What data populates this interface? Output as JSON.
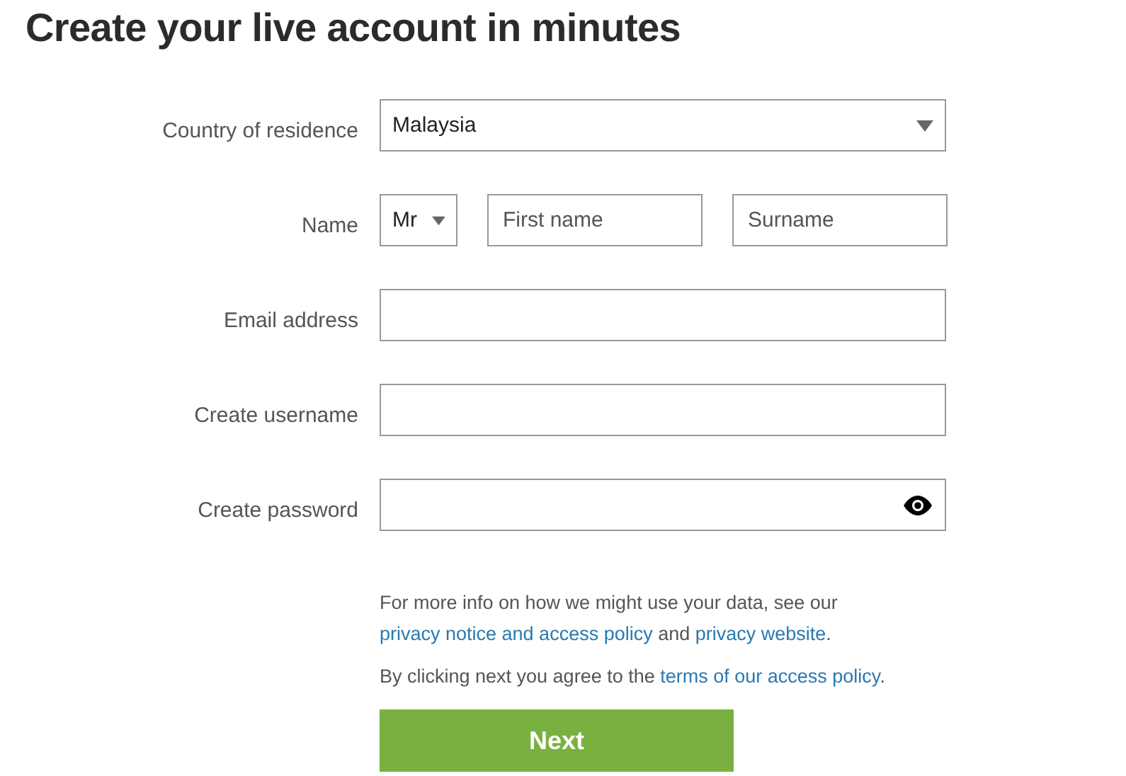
{
  "title": "Create your live account in minutes",
  "fields": [
    {
      "kind": "select",
      "label": "Country of residence",
      "value": "Malaysia"
    },
    {
      "kind": "name",
      "label": "Name",
      "salutation": "Mr",
      "first_placeholder": "First name",
      "last_placeholder": "Surname"
    },
    {
      "kind": "text",
      "label": "Email address"
    },
    {
      "kind": "text",
      "label": "Create username"
    },
    {
      "kind": "password",
      "label": "Create password"
    }
  ],
  "notices": [
    [
      {
        "kind": "text",
        "text": "For more info on how we might use your data, see our "
      },
      {
        "kind": "link",
        "text": "privacy notice and access policy"
      },
      {
        "kind": "text",
        "text": " and "
      },
      {
        "kind": "link",
        "text": "privacy website"
      },
      {
        "kind": "text",
        "text": "."
      }
    ],
    [
      {
        "kind": "text",
        "text": "By clicking next you agree to the "
      },
      {
        "kind": "link",
        "text": "terms of our access policy"
      },
      {
        "kind": "text",
        "text": "."
      }
    ]
  ],
  "button": "Next"
}
